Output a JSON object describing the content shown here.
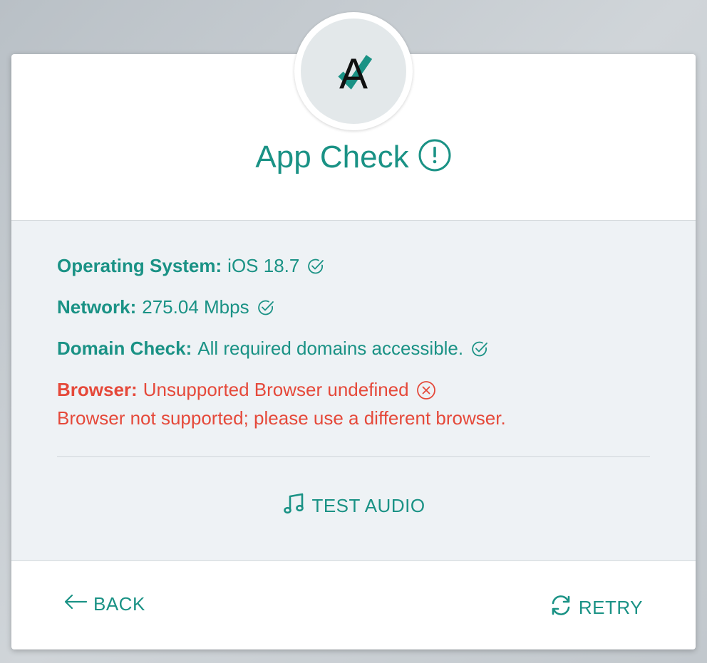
{
  "header": {
    "title": "App Check",
    "logo_letter": "A",
    "status_icon": "alert-circle-icon"
  },
  "checks": [
    {
      "label": "Operating System:",
      "value": "iOS 18.7",
      "status": "ok",
      "icon": "check-circle-icon"
    },
    {
      "label": "Network:",
      "value": "275.04 Mbps",
      "status": "ok",
      "icon": "check-circle-icon"
    },
    {
      "label": "Domain Check:",
      "value": "All required domains accessible.",
      "status": "ok",
      "icon": "check-circle-icon"
    },
    {
      "label": "Browser:",
      "value": "Unsupported Browser undefined",
      "status": "error",
      "icon": "x-circle-icon"
    }
  ],
  "browser_error_message": "Browser not supported; please use a different browser.",
  "actions": {
    "test_audio_label": "TEST AUDIO",
    "back_label": "BACK",
    "retry_label": "RETRY"
  },
  "colors": {
    "accent": "#1a9285",
    "error": "#e5493a",
    "panel_bg": "#eef2f5"
  }
}
